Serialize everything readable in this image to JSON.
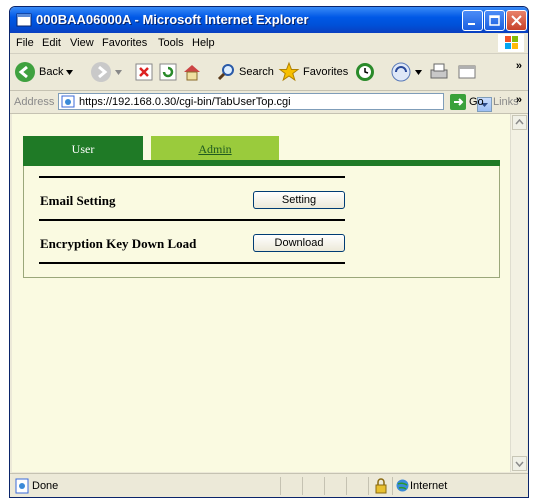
{
  "window": {
    "title": "000BAA06000A - Microsoft Internet Explorer"
  },
  "menu": [
    "File",
    "Edit",
    "View",
    "Favorites",
    "Tools",
    "Help"
  ],
  "toolbar": {
    "back": "Back",
    "search": "Search",
    "favorites": "Favorites"
  },
  "address": {
    "label": "Address",
    "url": "https://192.168.0.30/cgi-bin/TabUserTop.cgi",
    "go": "Go",
    "links": "Links"
  },
  "tabs": {
    "user": "User",
    "admin": "Admin"
  },
  "rows": [
    {
      "label": "Email Setting",
      "button": "Setting"
    },
    {
      "label": "Encryption Key Down Load",
      "button": "Download"
    }
  ],
  "status": {
    "text": "Done",
    "zone": "Internet"
  },
  "colors": {
    "tab_active": "#1f7a26",
    "tab_inactive": "#9acb3c",
    "page_bg": "#fafae1"
  }
}
